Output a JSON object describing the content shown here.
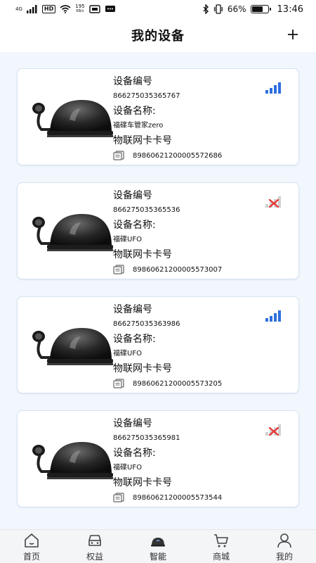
{
  "status_bar": {
    "network": "4G",
    "hd": "HD",
    "speed_value": "195",
    "speed_unit": "KB/s",
    "battery": "66%",
    "time": "13:46"
  },
  "header": {
    "title": "我的设备"
  },
  "labels": {
    "device_no": "设备编号",
    "device_name": "设备名称:",
    "iot_card": "物联网卡卡号"
  },
  "devices": [
    {
      "device_no": "866275035365767",
      "name": "福碟车管家zero",
      "iccid": "89860621200005572686",
      "signal": "strong"
    },
    {
      "device_no": "866275035365536",
      "name": "福碟UFO",
      "iccid": "89860621200005573007",
      "signal": "none"
    },
    {
      "device_no": "866275035363986",
      "name": "福碟UFO",
      "iccid": "89860621200005573205",
      "signal": "strong"
    },
    {
      "device_no": "866275035365981",
      "name": "福碟UFO",
      "iccid": "89860621200005573544",
      "signal": "none"
    }
  ],
  "tabbar": {
    "active": "智能",
    "items": [
      {
        "label": "首页",
        "icon": "home-icon"
      },
      {
        "label": "权益",
        "icon": "car-icon"
      },
      {
        "label": "智能",
        "icon": "device-icon"
      },
      {
        "label": "商城",
        "icon": "cart-icon"
      },
      {
        "label": "我的",
        "icon": "user-icon"
      }
    ]
  },
  "colors": {
    "page_bg": "#f1f7fd",
    "signal_blue": "#2f6fe0",
    "no_signal_red": "#e53935"
  }
}
